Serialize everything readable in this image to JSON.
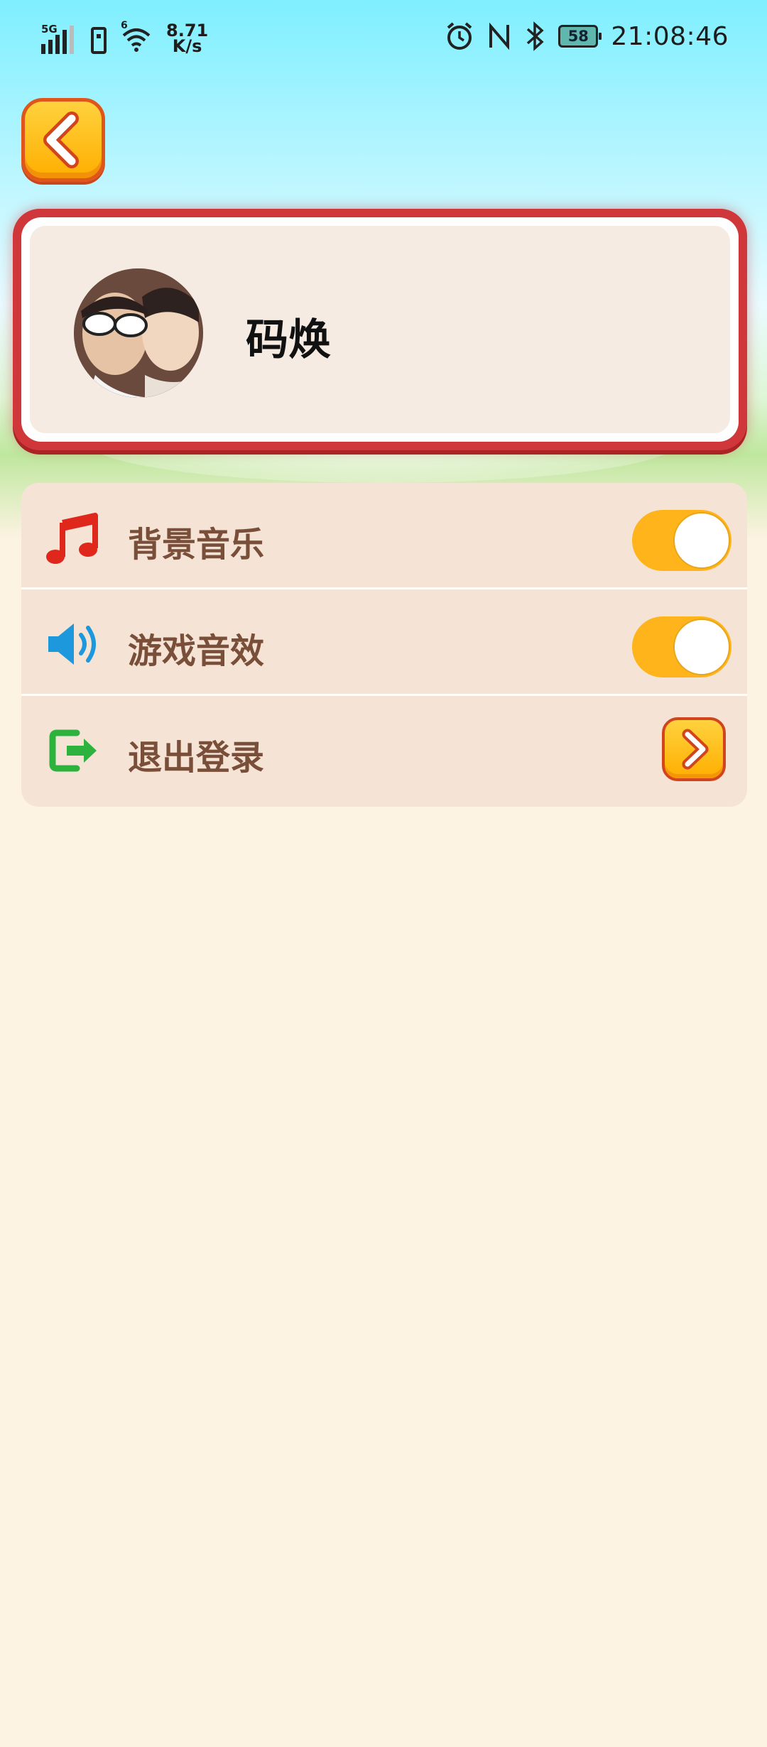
{
  "status_bar": {
    "network": "5G",
    "wifi_badge": "6",
    "speed_value": "8.71",
    "speed_unit": "K/s",
    "battery": "58",
    "time": "21:08:46",
    "icons": [
      "signal-icon",
      "sim-icon",
      "wifi-icon",
      "alarm-icon",
      "nfc-icon",
      "bluetooth-icon",
      "battery-icon"
    ]
  },
  "header": {
    "back_icon": "chevron-left-icon"
  },
  "profile": {
    "name": "码焕",
    "avatar": "avatar"
  },
  "settings": {
    "items": [
      {
        "label": "背景音乐",
        "icon": "music-note-icon",
        "icon_color": "#e0271c",
        "control": "toggle",
        "on": true
      },
      {
        "label": "游戏音效",
        "icon": "speaker-icon",
        "icon_color": "#1e98dc",
        "control": "toggle",
        "on": true
      },
      {
        "label": "退出登录",
        "icon": "logout-icon",
        "icon_color": "#2db33d",
        "control": "button"
      }
    ]
  },
  "colors": {
    "accent": "#ffb41c",
    "card_border": "#d0373a",
    "label_brown": "#7a4f3a",
    "page_bg": "#fdf3e3"
  }
}
